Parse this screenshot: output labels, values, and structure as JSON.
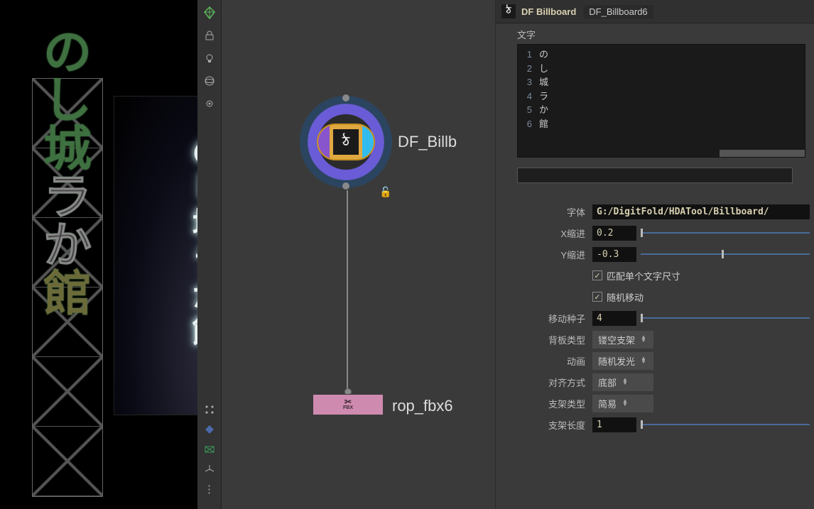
{
  "header": {
    "type_label": "DF Billboard",
    "name": "DF_Billboard6"
  },
  "text_list": {
    "label": "文字",
    "lines": [
      "の",
      "し",
      "城",
      "ラ",
      "か",
      "館"
    ]
  },
  "nodes": {
    "main_label": "DF_Billb",
    "fbx_label": "rop_fbx6"
  },
  "params": {
    "font_label": "字体",
    "font_value": "G:/DigitFold/HDATool/Billboard/",
    "x_indent_label": "X缩进",
    "x_indent_value": "0.2",
    "y_indent_label": "Y缩进",
    "y_indent_value": "-0.3",
    "match_single_label": "匹配单个文字尺寸",
    "random_move_label": "随机移动",
    "seed_label": "移动种子",
    "seed_value": "4",
    "back_type_label": "背板类型",
    "back_type_value": "镂空支架",
    "anim_label": "动画",
    "anim_value": "随机发光",
    "align_label": "对齐方式",
    "align_value": "底部",
    "bracket_type_label": "支架类型",
    "bracket_type_value": "简易",
    "bracket_len_label": "支架长度",
    "bracket_len_value": "1"
  }
}
